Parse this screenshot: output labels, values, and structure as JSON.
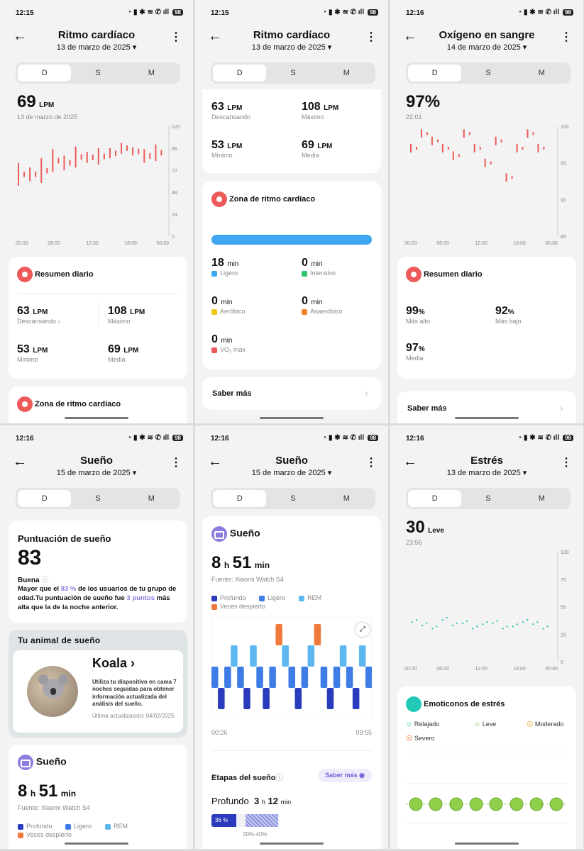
{
  "status": {
    "t1": "12:15",
    "t2": "12:15",
    "t3": "12:16",
    "t4": "12:16",
    "t5": "12:16",
    "t6": "12:16",
    "battery": "98"
  },
  "tabs": {
    "d": "D",
    "s": "S",
    "m": "M"
  },
  "p1": {
    "title": "Ritmo cardíaco",
    "date": "13 de marzo de 2025",
    "value": "69",
    "unit": "LPM",
    "value_date": "13 de marzo de 2025",
    "yticks": [
      "120",
      "96",
      "72",
      "48",
      "24",
      "0"
    ],
    "xticks": [
      "00:00",
      "06:00",
      "12:00",
      "18:00",
      "00:00"
    ],
    "summary_title": "Resumen diario",
    "rest": "63",
    "rest_lbl": "Descansando",
    "max": "108",
    "max_lbl": "Máximo",
    "min": "53",
    "min_lbl": "Mínimo",
    "avg": "69",
    "avg_lbl": "Media",
    "zone_title": "Zona de ritmo cardíaco"
  },
  "p2": {
    "title": "Ritmo cardíaco",
    "date": "13 de marzo de 2025",
    "rest": "63",
    "rest_lbl": "Descansando",
    "max": "108",
    "max_lbl": "Máximo",
    "min": "53",
    "min_lbl": "Mínimo",
    "avg": "69",
    "avg_lbl": "Media",
    "zone_title": "Zona de ritmo cardíaco",
    "z1": "18",
    "z1_lbl": "Ligero",
    "z2": "0",
    "z2_lbl": "Intensivo",
    "z3": "0",
    "z3_lbl": "Aeróbico",
    "z4": "0",
    "z4_lbl": "Anaeróbico",
    "z5": "0",
    "z5_lbl": "VO₂ max",
    "min_unit": "min",
    "learn": "Saber más"
  },
  "p3": {
    "title": "Oxígeno en sangre",
    "date": "14 de marzo de 2025",
    "value": "97%",
    "time": "22:01",
    "yticks": [
      "100",
      "95",
      "90",
      "85"
    ],
    "xticks": [
      "00:00",
      "06:00",
      "12:00",
      "18:00",
      "00:00"
    ],
    "summary_title": "Resumen diario",
    "high": "99",
    "high_lbl": "Más alto",
    "low": "92",
    "low_lbl": "Más bajo",
    "avg": "97",
    "avg_lbl": "Media",
    "pct": "%",
    "learn": "Saber más"
  },
  "p4": {
    "title": "Sueño",
    "date": "15 de marzo de 2025",
    "score_title": "Puntuación de sueño",
    "score": "83",
    "quality": "Buena",
    "desc1": "Mayor que el ",
    "desc_pct": "83 %",
    "desc2": " de los usuarios de tu grupo de edad.Tu puntuación de sueño fue ",
    "desc_pts": "3 puntos",
    "desc3": " más alta que la de la noche anterior.",
    "animal_title": "Tu animal de sueño",
    "animal": "Koala",
    "animal_desc": "Utiliza tu dispositivo en cama 7 noches seguidas para obtener información actualizada del análisis del sueño.",
    "updated": "Última actualización: 04/02/2025",
    "sleep_title": "Sueño",
    "h": "8",
    "m": "51",
    "source": "Fuente: Xiaomi Watch S4",
    "l_deep": "Profundo",
    "l_light": "Ligero",
    "l_rem": "REM",
    "l_awake": "Veces despierto"
  },
  "p5": {
    "title": "Sueño",
    "date": "15 de marzo de 2025",
    "sleep_title": "Sueño",
    "h": "8",
    "m": "51",
    "source": "Fuente: Xiaomi Watch S4",
    "l_deep": "Profundo",
    "l_light": "Ligero",
    "l_rem": "REM",
    "l_awake": "Veces despierto",
    "start": "00:26",
    "end": "09:55",
    "stages": "Etapas del sueño",
    "learn": "Saber más",
    "deep": "Profundo",
    "deep_h": "3",
    "deep_m": "12",
    "deep_pct": "36 %",
    "deep_range": "20%-40%"
  },
  "p6": {
    "title": "Estrés",
    "date": "13 de marzo de 2025",
    "value": "30",
    "level": "Leve",
    "time": "23:56",
    "yticks": [
      "100",
      "75",
      "50",
      "25",
      "0"
    ],
    "xticks": [
      "00:00",
      "06:00",
      "12:00",
      "18:00",
      "00:00"
    ],
    "emo_title": "Emoticonos de estrés",
    "e1": "Relajado",
    "e2": "Leve",
    "e3": "Moderado",
    "e4": "Severo"
  },
  "colors": {
    "red": "#ec5a59",
    "deep": "#2a3bbd",
    "light": "#3f7de6",
    "rem": "#5db8f0",
    "awake": "#f07a3c",
    "purple": "#8b7de0",
    "teal": "#22c9b6",
    "blue_bar": "#3fa7f2"
  },
  "chart_data": [
    {
      "type": "bar",
      "title": "",
      "ylim": [
        0,
        120
      ],
      "x": [
        "00:00",
        "06:00",
        "12:00",
        "18:00",
        "00:00"
      ],
      "series": [
        {
          "values": [
            [
              55,
              80
            ],
            [
              60,
              75
            ],
            [
              58,
              85
            ],
            [
              70,
              95
            ],
            [
              72,
              88
            ],
            [
              75,
              98
            ],
            [
              80,
              92
            ],
            [
              78,
              96
            ],
            [
              85,
              96
            ],
            [
              90,
              102
            ],
            [
              88,
              97
            ],
            [
              80,
              95
            ],
            [
              82,
              100
            ]
          ]
        }
      ]
    },
    {
      "type": "scatter",
      "ylim": [
        85,
        100
      ],
      "series": [
        {
          "values": [
            97,
            99,
            98,
            97,
            96,
            99,
            97,
            95,
            98,
            93,
            97,
            99,
            97
          ]
        }
      ]
    },
    {
      "type": "scatter",
      "ylim": [
        0,
        100
      ],
      "series": [
        {
          "values": [
            36,
            33,
            30,
            38,
            33,
            35,
            30,
            34,
            35,
            30,
            32,
            36,
            34,
            30
          ]
        }
      ]
    }
  ]
}
